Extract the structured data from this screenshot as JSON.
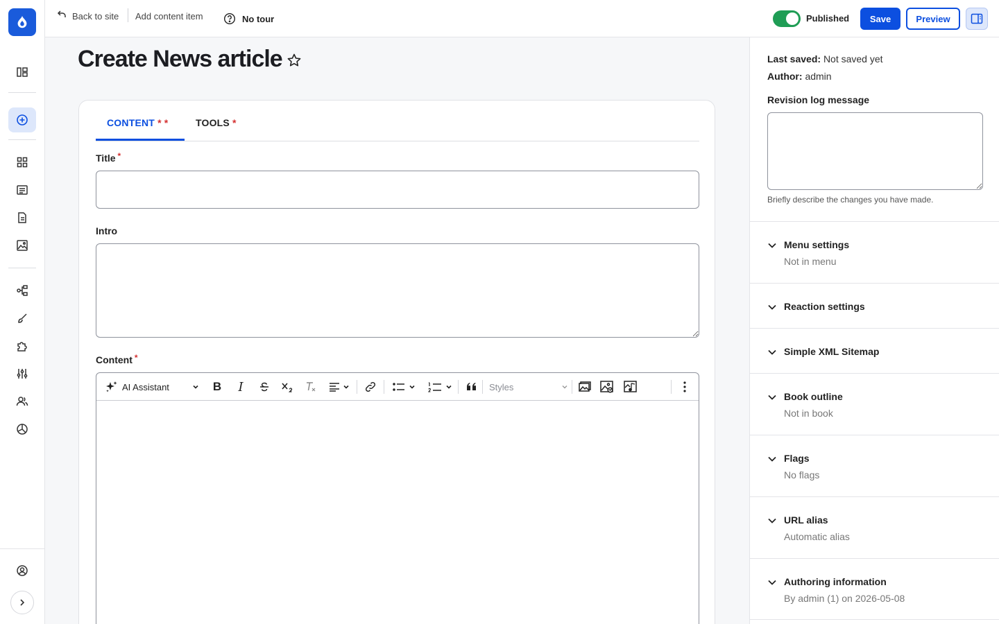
{
  "topbar": {
    "back_label": "Back to site",
    "add_content_label": "Add content item",
    "tour_label": "No tour",
    "published_label": "Published",
    "save_label": "Save",
    "preview_label": "Preview"
  },
  "page": {
    "title": "Create News article"
  },
  "tabs": [
    {
      "label": "CONTENT",
      "required_marks": "* *"
    },
    {
      "label": "TOOLS",
      "required_marks": "*"
    }
  ],
  "fields": {
    "title_label": "Title",
    "title_value": "",
    "intro_label": "Intro",
    "intro_value": "",
    "content_label": "Content",
    "required_mark": "*"
  },
  "editor": {
    "ai_label": "AI Assistant",
    "styles_placeholder": "Styles"
  },
  "sidebar": {
    "last_saved_label": "Last saved:",
    "last_saved_value": "Not saved yet",
    "author_label": "Author:",
    "author_value": "admin",
    "revision_label": "Revision log message",
    "revision_help": "Briefly describe the changes you have made.",
    "sections": [
      {
        "title": "Menu settings",
        "summary": "Not in menu"
      },
      {
        "title": "Reaction settings",
        "summary": ""
      },
      {
        "title": "Simple XML Sitemap",
        "summary": ""
      },
      {
        "title": "Book outline",
        "summary": "Not in book"
      },
      {
        "title": "Flags",
        "summary": "No flags"
      },
      {
        "title": "URL alias",
        "summary": "Automatic alias"
      },
      {
        "title": "Authoring information",
        "summary": "By admin (1) on 2026-05-08"
      }
    ]
  },
  "colors": {
    "accent": "#0c4fe0",
    "published": "#1f9d55",
    "required": "#d43030"
  }
}
